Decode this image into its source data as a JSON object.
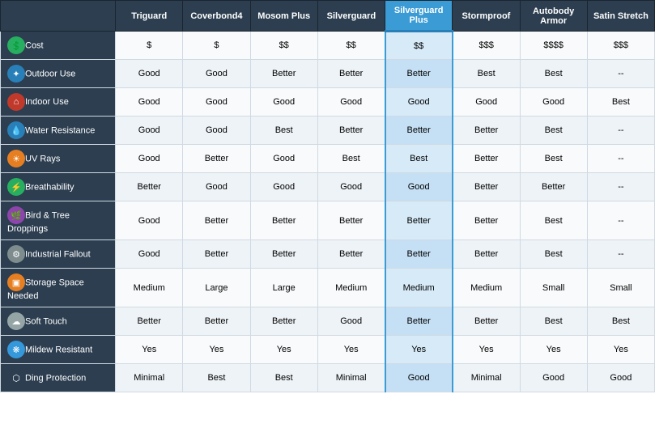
{
  "columns": [
    {
      "id": "feature",
      "label": "",
      "highlighted": false
    },
    {
      "id": "triguard",
      "label": "Triguard",
      "highlighted": false
    },
    {
      "id": "coverbond4",
      "label": "Coverbond4",
      "highlighted": false
    },
    {
      "id": "mosomplus",
      "label": "Mosom Plus",
      "highlighted": false
    },
    {
      "id": "silverguard",
      "label": "Silverguard",
      "highlighted": false
    },
    {
      "id": "silverguardplus",
      "label": "Silverguard Plus",
      "highlighted": true
    },
    {
      "id": "stormproof",
      "label": "Stormproof",
      "highlighted": false
    },
    {
      "id": "autobodyarmor",
      "label": "Autobody Armor",
      "highlighted": false
    },
    {
      "id": "satinstretch",
      "label": "Satin Stretch",
      "highlighted": false
    }
  ],
  "rows": [
    {
      "feature": "Cost",
      "icon": "$",
      "iconClass": "icon-dollar",
      "values": [
        "$",
        "$",
        "$$",
        "$$",
        "$$",
        "$$$",
        "$$$$",
        "$$$"
      ]
    },
    {
      "feature": "Outdoor Use",
      "icon": "❄",
      "iconClass": "icon-outdoor",
      "values": [
        "Good",
        "Good",
        "Better",
        "Better",
        "Better",
        "Best",
        "Best",
        "--"
      ]
    },
    {
      "feature": "Indoor Use",
      "icon": "🏠",
      "iconClass": "icon-indoor",
      "values": [
        "Good",
        "Good",
        "Good",
        "Good",
        "Good",
        "Good",
        "Good",
        "Best"
      ]
    },
    {
      "feature": "Water Resistance",
      "icon": "💧",
      "iconClass": "icon-water",
      "values": [
        "Good",
        "Good",
        "Best",
        "Better",
        "Better",
        "Better",
        "Best",
        "--"
      ]
    },
    {
      "feature": "UV Rays",
      "icon": "☀",
      "iconClass": "icon-uv",
      "values": [
        "Good",
        "Better",
        "Good",
        "Best",
        "Best",
        "Better",
        "Best",
        "--"
      ]
    },
    {
      "feature": "Breathability",
      "icon": "⚡",
      "iconClass": "icon-breath",
      "values": [
        "Better",
        "Good",
        "Good",
        "Good",
        "Good",
        "Better",
        "Better",
        "--"
      ]
    },
    {
      "feature": "Bird & Tree Droppings",
      "icon": "🍃",
      "iconClass": "icon-bird",
      "values": [
        "Good",
        "Better",
        "Better",
        "Better",
        "Better",
        "Better",
        "Best",
        "--"
      ]
    },
    {
      "feature": "Industrial Fallout",
      "icon": "🔧",
      "iconClass": "icon-industrial",
      "values": [
        "Good",
        "Better",
        "Better",
        "Better",
        "Better",
        "Better",
        "Best",
        "--"
      ]
    },
    {
      "feature": "Storage Space Needed",
      "icon": "📦",
      "iconClass": "icon-storage",
      "values": [
        "Medium",
        "Large",
        "Large",
        "Medium",
        "Medium",
        "Medium",
        "Small",
        "Small"
      ]
    },
    {
      "feature": "Soft Touch",
      "icon": "☁",
      "iconClass": "icon-soft",
      "values": [
        "Better",
        "Better",
        "Better",
        "Good",
        "Better",
        "Better",
        "Best",
        "Best"
      ]
    },
    {
      "feature": "Mildew Resistant",
      "icon": "❄",
      "iconClass": "icon-mildew",
      "values": [
        "Yes",
        "Yes",
        "Yes",
        "Yes",
        "Yes",
        "Yes",
        "Yes",
        "Yes"
      ]
    },
    {
      "feature": "Ding Protection",
      "icon": "🛡",
      "iconClass": "icon-ding",
      "values": [
        "Minimal",
        "Best",
        "Best",
        "Minimal",
        "Good",
        "Minimal",
        "Good",
        "Good"
      ]
    }
  ],
  "icons": {
    "dollar": "💲",
    "outdoor": "❄",
    "indoor": "🏠",
    "water": "💧",
    "uv": "☀",
    "breath": "⚡",
    "bird": "🍃",
    "industrial": "🔧",
    "storage": "📦",
    "soft": "☁",
    "mildew": "❄",
    "ding": "🛡"
  }
}
